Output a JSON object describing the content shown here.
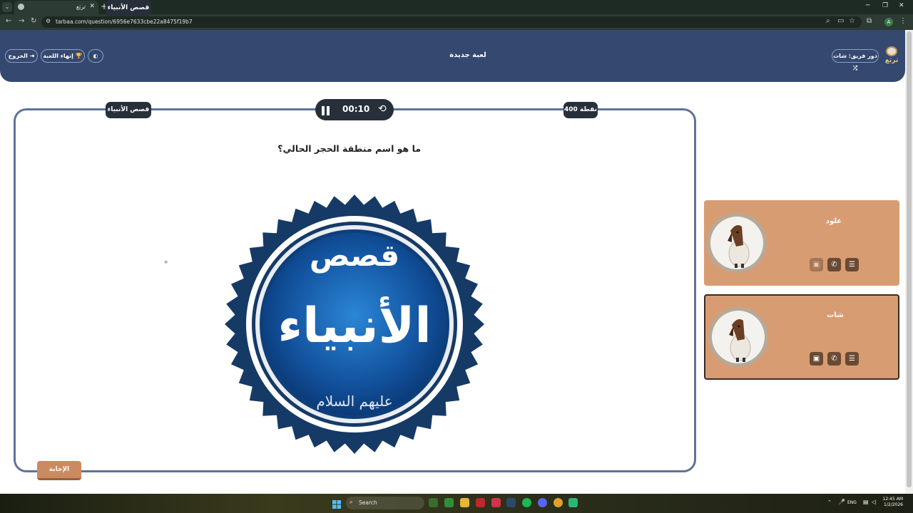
{
  "browser": {
    "tab_title": "تربَع",
    "url": "tarbaa.com/question/6956e7633cbe22a8475f19b7",
    "profile_initial": "A"
  },
  "header": {
    "title": "لعبة جديدة",
    "exit_label": "الخروج",
    "end_game_label": "إنهاء اللعبة",
    "turn_label": "دور فريق: شات",
    "logo_text": "تربَع"
  },
  "question": {
    "category": "قصص الأنبياء",
    "points": "400 نقطة",
    "timer": "00:10",
    "text": "ما هو اسم منطقة الحجر الحالي؟",
    "answer_label": "الإجابة",
    "image": {
      "title": "قصص",
      "main": "الأنبياء",
      "subtitle": "عليهم السلام"
    }
  },
  "teams": [
    {
      "name": "علود"
    },
    {
      "name": "شات"
    }
  ],
  "taskbar": {
    "search": "Search",
    "lang": "ENG",
    "time": "12:45 AM",
    "date": "1/2/2026"
  },
  "colors": {
    "header": "#344870",
    "card_border": "#5f7399",
    "team_card": "#d89c73",
    "answer_button": "#cc8a60",
    "pill": "#262f3a"
  }
}
